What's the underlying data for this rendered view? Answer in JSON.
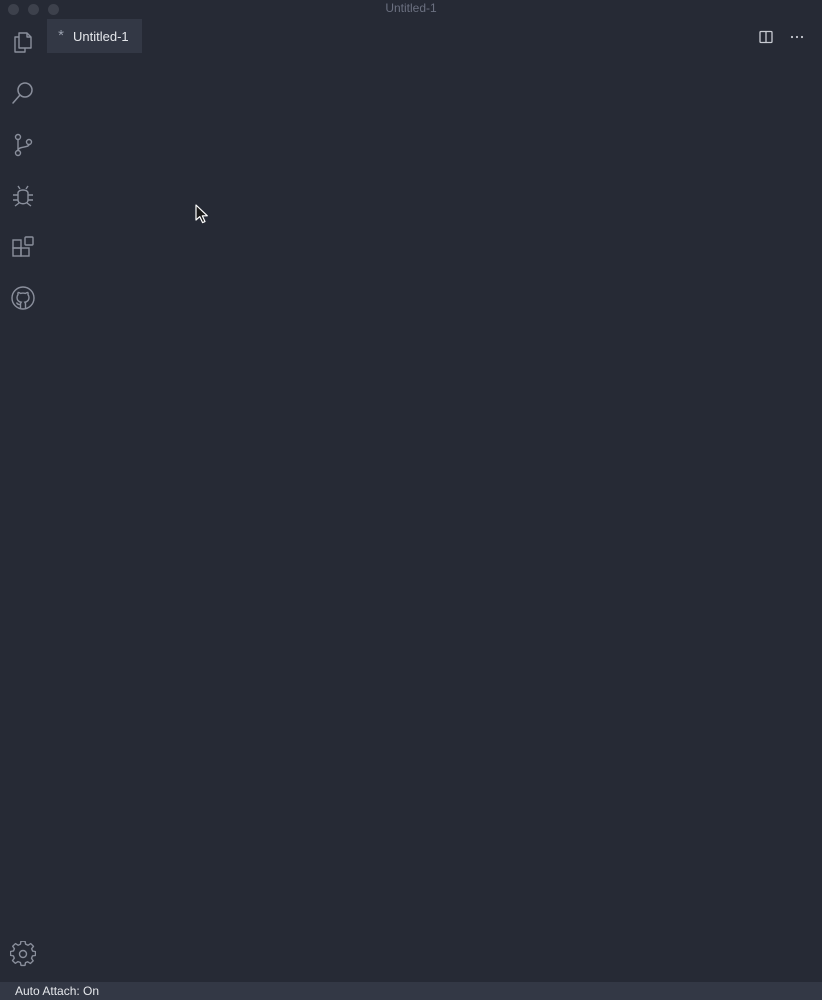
{
  "window": {
    "title": "Untitled-1"
  },
  "activity_bar": {
    "items": [
      {
        "icon": "files-icon",
        "name": "Explorer"
      },
      {
        "icon": "search-icon",
        "name": "Search"
      },
      {
        "icon": "source-control-icon",
        "name": "Source Control"
      },
      {
        "icon": "debug-icon",
        "name": "Run and Debug"
      },
      {
        "icon": "extensions-icon",
        "name": "Extensions"
      },
      {
        "icon": "github-icon",
        "name": "GitHub"
      }
    ],
    "manage_icon": "gear-icon"
  },
  "tabs": [
    {
      "label": "Untitled-1",
      "dirty_marker": "*",
      "active": true
    }
  ],
  "editor_actions": {
    "split_icon": "split-editor-icon",
    "more_label": "···"
  },
  "status_bar": {
    "auto_attach": "Auto Attach: On"
  },
  "colors": {
    "background": "#262a35",
    "tab_active": "#333845",
    "status_bar": "#333845",
    "icon": "#8a8f9c"
  }
}
